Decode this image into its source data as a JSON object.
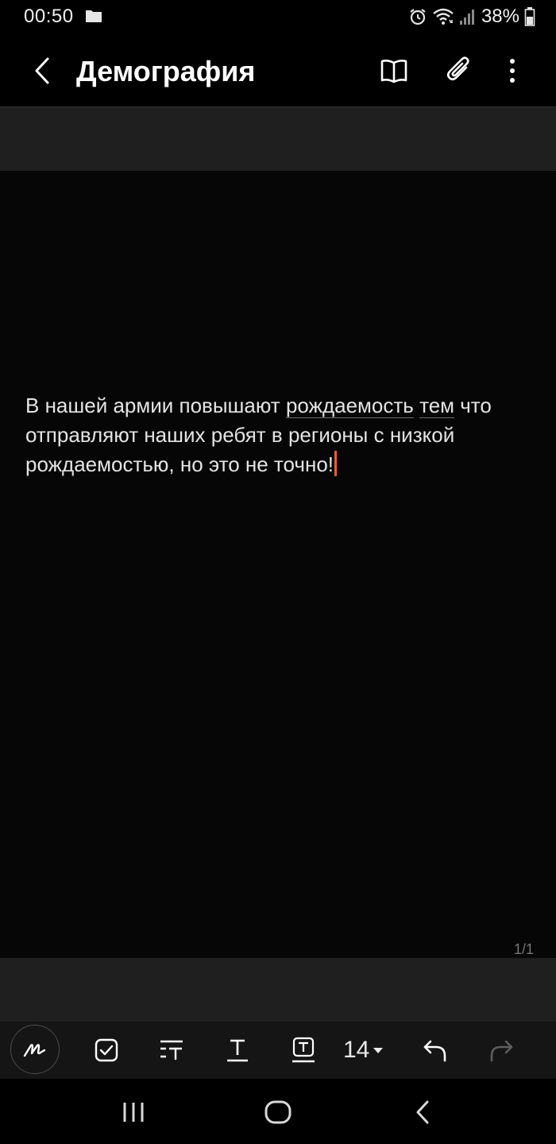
{
  "status_bar": {
    "time": "00:50",
    "battery_percent": "38%",
    "icons": [
      "folder-icon",
      "alarm-icon",
      "wifi-icon",
      "signal-icon",
      "battery-icon"
    ]
  },
  "app_bar": {
    "title": "Демография",
    "icons": [
      "back-icon",
      "reading-mode-icon",
      "attach-icon",
      "more-icon"
    ]
  },
  "note": {
    "text_before": "В нашей армии повышают ",
    "underlined_1": "рождаемость",
    "text_mid": " ",
    "underlined_2": "тем",
    "text_after": " что отправляют наших ребят в регионы с низкой рождаемостью, но это не точно!",
    "accent_color": "#ff5a33"
  },
  "page_indicator": "1/1",
  "bottom_toolbar": {
    "font_size": "14",
    "icons": [
      "pen-icon",
      "checkbox-icon",
      "text-style-icon",
      "text-underline-icon",
      "text-box-icon",
      "dropdown-arrow-icon",
      "undo-icon",
      "redo-icon"
    ]
  },
  "nav_bar": {
    "icons": [
      "recents-icon",
      "home-icon",
      "back-nav-icon"
    ]
  }
}
